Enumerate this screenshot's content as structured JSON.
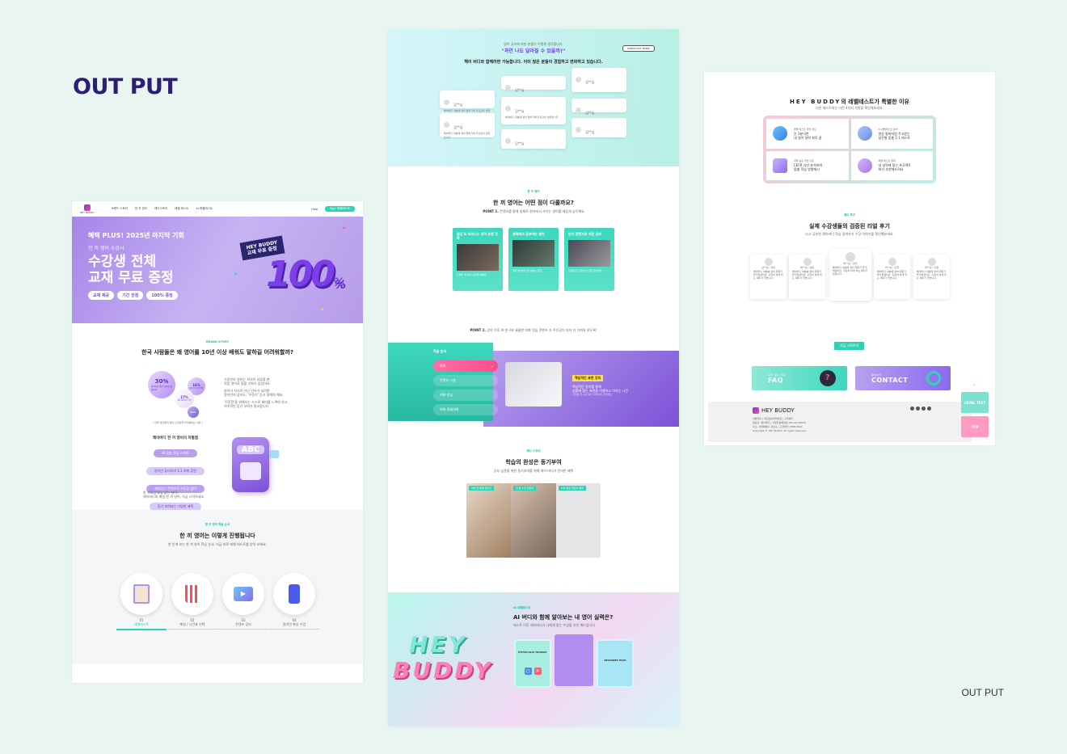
{
  "titles": {
    "main": "OUT PUT",
    "caption": "OUT PUT"
  },
  "p1": {
    "nav": {
      "brand": "HEY BUDDY",
      "items": [
        "브랜드 스토리",
        "한 끼 영어",
        "레디스토리",
        "레벨 테스트",
        "AI 레벨테스트"
      ],
      "login": "Help",
      "cta": "Sign 레벨테스트"
    },
    "hero": {
      "line1": "혜택 PLUS! 2025년 마지막 기회",
      "line2": "한 끼 영어 수강시",
      "line3a": "수강생 전체",
      "line3b": "교재 무료 증정",
      "chips": [
        "교재 제공",
        "기간 한정",
        "100% 증정"
      ],
      "tag1": "HEY BUDDY",
      "tag2": "교재 무료 증정",
      "big": "100",
      "percent": "%"
    },
    "story": {
      "label": "BRAND STORY",
      "title": "한국 사람들은 왜 영어를 10년 이상 배워도 말하길 어려워할까?",
      "c1": "30%",
      "c1_sub": "영어학습 방법 지속이 실패하여",
      "c2": "16%",
      "c2_sub": "목표 유지 실패 이유",
      "c3": "17%",
      "c3_sub": "재미 없음 동기 부족",
      "c4": "12%",
      "t1": "그동안의 영어는 지식이 되었을 뿐,",
      "t2": "직접 영어로 말할 기회가 없었어요.",
      "t3": "영어가 지식이 아닌 언어가 되려면",
      "t4": "영어만의 감하도, '꾸준히' 듣고 말해야 해요.",
      "t5": "'꾸준함'을 위해서는 스스로 재미를 느껴야 하고,",
      "t6": "지속적인 동기 부여가 필요합니다.",
      "caption": "[ 한국 성인들의 영어 스피킹을 어려워하는 이유 ]"
    },
    "diff": {
      "title": "헤이버디 한 끼 영어의 차별점",
      "pills": [
        "AI 맞춤 학습 스피킹",
        "원어민 튜터와의 1:1 회화 훈련",
        "재미있는 콘텐츠로 지루함 없이",
        "동기 부여되는 다양한 혜택"
      ],
      "abc": "ABC",
      "desc1": "한 끼처럼 부담 없는 영어,",
      "desc2": "헤이버디와 매일 한 끼 영어, 지금 시작하세요"
    },
    "process": {
      "label": "한 끼 영어 학습 순서",
      "title": "한 끼 영어는 이렇게 진행됩니다",
      "desc": "한 눈에 보는 한 끼 영어 학습 순서, 지금 바로 레벨 테스트를 받아 보세요.",
      "steps": [
        {
          "num": "01",
          "label": "레벨테스트"
        },
        {
          "num": "02",
          "label": "매칭 / 시간표 선택"
        },
        {
          "num": "03",
          "label": "콘텐츠 강의"
        },
        {
          "num": "04",
          "label": "원어민 화상 수업"
        }
      ]
    }
  },
  "p2": {
    "top": {
      "q": "영어 공부에 지친 분들이 이렇게 생각합니다.",
      "title": "\"과연 나도 달라질 수 있을까?\"",
      "sub": "헤이 버디와 함께라면 가능합니다. 이미 많은 분들이 경험하고 변화하고 있습니다.",
      "btn": "CHECK OUT MORE",
      "reviewer": "김**님",
      "review_text": "헤이버디 덕분에 영어 말하기에 자신감이 생겼습니다."
    },
    "diff": {
      "label": "한 끼 영어",
      "title": "한 끼 영어는 어떤 점이 다를까요?",
      "point1_key": "POINT 1.",
      "point1": "콘텐츠를 통해 실제로 현지에서 쓰이는 영어를 재밌게 습득해요",
      "cards": [
        {
          "title": "일상 & 비즈니스 영어 표현 정복",
          "text": "드라마 속 영어 표현을 배워요"
        },
        {
          "title": "영화에서 공부하는 영어",
          "text": "영화 명장면으로 익히는 표현"
        },
        {
          "title": "인기 콘텐츠로 쉬운 공부",
          "text": "트렌디한 콘텐츠로 쉽게 학습해요"
        }
      ],
      "point2_key": "POINT 2.",
      "point2": "강의 이후 AI 친구와 꿀꿀한 대화 연습 콘텐츠 속 주인공이 되어 더 가까워 보도록!"
    },
    "order": {
      "label": "학습 순서",
      "menu": [
        "강의",
        "콘텐츠 시청",
        "AI와 연습",
        "AI와 꿀꿀대화"
      ],
      "popup_title": "핵심적인 표현 강의",
      "popup_text1": "핵심적인 강의를 통해",
      "popup_text2": "상황에 맞는 표현을 이해하고 익히는 시간",
      "popup_text3": "가르를 한 시간 동안 다양하게 학습해요"
    },
    "motive": {
      "label": "레디 스토리",
      "title": "학습의 완성은 동기부여",
      "sub": "공부 습관을 위한 동기부여를 위해 헤이 버디가 준비한 혜택",
      "tags": [
        "레벨 업 혜택 챌린지",
        "한 달 수강 챌린지",
        "이미 완료 챌린지 혜택"
      ]
    },
    "ai": {
      "label": "AI 레벨테스트",
      "title": "AI 버디와 함께 알아보는 내 영어 실력은?",
      "sub": "테스트 이후 레이버디가 나에게 맞는 수업을 추천 해드립니다.",
      "hey": "HEY",
      "buddy": "BUDDY",
      "card1": "PHYSICALLY HUNGRY",
      "card3": "BEGINNER HIGH"
    }
  },
  "p3": {
    "title_brand": "HEY BUDDY",
    "title_rest": "의 레벨테스트가 특별한 이유",
    "sub": "다른 테스트와는 다른 4가지 차원을 확인해보세요.",
    "features": [
      {
        "t1": "레벨 테스트 학습 개요",
        "t2": "단 3분이면",
        "t3": "내 영어 실력 파악 끝"
      },
      {
        "t1": "AI 레벨테스트 분석",
        "t2": "영상 통화처럼 주고받는",
        "t3": "실전형 맞춤 1:1 테스트"
      },
      {
        "t1": "국제 표준 학습 기준",
        "t2": "CEFR 기반 분석하여",
        "t3": "맞춤 학습 방향제시"
      },
      {
        "t1": "레벨 테스트 결과",
        "t2": "내 실력에 맞는 프로젝트",
        "t3": "AI가 추천해드려요"
      }
    ],
    "review": {
      "label": "레디 후기",
      "title": "실제 수강생들의 검증된 리얼 후기",
      "sub": "다시 공부한 헤이버디 학습 참여자가 수강 이야기를 확인해보세요.",
      "names": [
        "김**님 / 강남",
        "박**님 / 강동",
        "박**님 / 강서",
        "이**님 / 인천",
        "최**님 / 수원"
      ],
      "text": "헤이버디 덕분에 영어 회화가 즐거워졌어요. 꾸준히 하게 되는 재미가 있습니다."
    },
    "cta": "지금 시작하기",
    "faq_small": "자주 묻는 질문",
    "faq": "FAQ",
    "contact_small": "문의하기",
    "contact": "CONTACT",
    "footer": {
      "brand": "HEY BUDDY",
      "links": "이용약관 | 개인정보처리방침 | 고객센터",
      "line1": "대표자: 헤이버디 | 사업자등록번호 000-00-00000",
      "line2": "주소: 서울특별시 강남구 | 고객센터 1588-0000",
      "line3": "Copyright © HEY BUDDY. All rights reserved."
    },
    "level_btn": "LEVEL TEST",
    "top_btn": "TOP"
  }
}
